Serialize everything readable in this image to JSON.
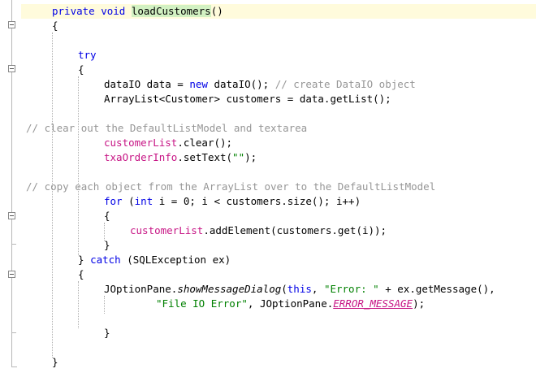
{
  "code_lines": [
    {
      "id": "l1",
      "parts": [
        {
          "t": "private",
          "c": "kw"
        },
        {
          "t": " "
        },
        {
          "t": "void",
          "c": "kw"
        },
        {
          "t": " "
        },
        {
          "t": "loadCustomers",
          "c": "hl"
        },
        {
          "t": "()"
        }
      ]
    },
    {
      "id": "l2",
      "parts": [
        {
          "t": "{"
        }
      ]
    },
    {
      "id": "l3",
      "parts": []
    },
    {
      "id": "l4",
      "parts": [
        {
          "t": "try",
          "c": "kw"
        }
      ]
    },
    {
      "id": "l5",
      "parts": [
        {
          "t": "{"
        }
      ]
    },
    {
      "id": "l6",
      "parts": [
        {
          "t": "dataIO data = "
        },
        {
          "t": "new",
          "c": "kw"
        },
        {
          "t": " dataIO(); "
        },
        {
          "t": "// create DataIO object",
          "c": "cm"
        }
      ]
    },
    {
      "id": "l7",
      "parts": [
        {
          "t": "ArrayList<Customer> customers = data.getList();"
        }
      ]
    },
    {
      "id": "l8",
      "parts": []
    },
    {
      "id": "l9",
      "parts": [
        {
          "t": "// clear out the DefaultListModel and textarea",
          "c": "cm"
        }
      ]
    },
    {
      "id": "l10",
      "parts": [
        {
          "t": "customerList",
          "c": "fld"
        },
        {
          "t": ".clear();"
        }
      ]
    },
    {
      "id": "l11",
      "parts": [
        {
          "t": "txaOrderInfo",
          "c": "fld"
        },
        {
          "t": ".setText("
        },
        {
          "t": "\"\"",
          "c": "str"
        },
        {
          "t": ");"
        }
      ]
    },
    {
      "id": "l12",
      "parts": []
    },
    {
      "id": "l13",
      "parts": [
        {
          "t": "// copy each object from the ArrayList over to the DefaultListModel",
          "c": "cm"
        }
      ]
    },
    {
      "id": "l14",
      "parts": [
        {
          "t": "for",
          "c": "kw"
        },
        {
          "t": " ("
        },
        {
          "t": "int",
          "c": "kw"
        },
        {
          "t": " i = 0; i < customers.size(); i++)"
        }
      ]
    },
    {
      "id": "l15",
      "parts": [
        {
          "t": "{"
        }
      ]
    },
    {
      "id": "l16",
      "parts": [
        {
          "t": "customerList",
          "c": "fld"
        },
        {
          "t": ".addElement(customers.get(i));"
        }
      ]
    },
    {
      "id": "l17",
      "parts": [
        {
          "t": "}"
        }
      ]
    },
    {
      "id": "l18",
      "parts": [
        {
          "t": "} "
        },
        {
          "t": "catch",
          "c": "kw"
        },
        {
          "t": " (SQLException ex)"
        }
      ]
    },
    {
      "id": "l19",
      "parts": [
        {
          "t": "{"
        }
      ]
    },
    {
      "id": "l20",
      "parts": [
        {
          "t": "JOptionPane."
        },
        {
          "t": "showMessageDialog",
          "c": "ital"
        },
        {
          "t": "("
        },
        {
          "t": "this",
          "c": "kw"
        },
        {
          "t": ", "
        },
        {
          "t": "\"Error: \"",
          "c": "str"
        },
        {
          "t": " + ex.getMessage(),"
        }
      ]
    },
    {
      "id": "l21",
      "parts": [
        {
          "t": "\"File IO Error\"",
          "c": "str"
        },
        {
          "t": ", JOptionPane."
        },
        {
          "t": "ERROR_MESSAGE",
          "c": "cst"
        },
        {
          "t": ");"
        }
      ]
    },
    {
      "id": "l22",
      "parts": []
    },
    {
      "id": "l23",
      "parts": [
        {
          "t": "}"
        }
      ]
    },
    {
      "id": "l24",
      "parts": []
    },
    {
      "id": "l25",
      "parts": [
        {
          "t": "}"
        }
      ]
    }
  ]
}
